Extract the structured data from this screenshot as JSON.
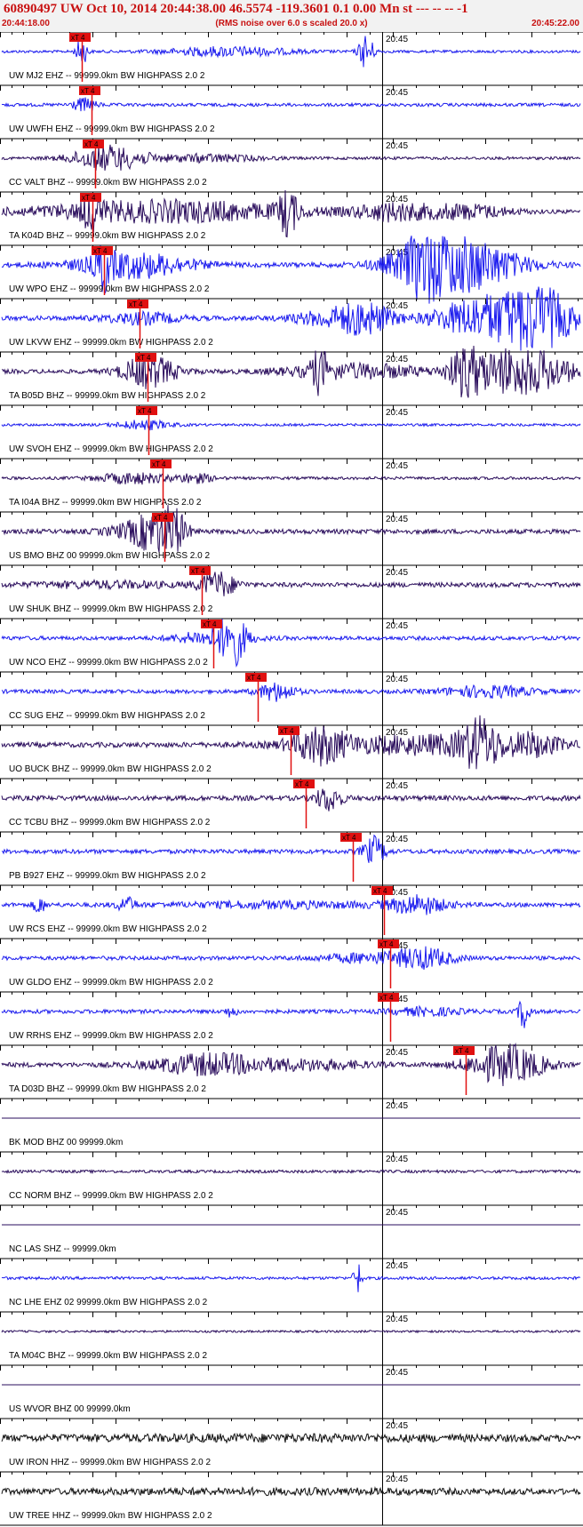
{
  "header": {
    "title": "60890497 UW Oct 10, 2014 20:44:38.00   46.5574 -119.3601  0.1 0.00 Mn st --- -- --  -1",
    "start_time": "20:44:18.00",
    "rms_note": "(RMS noise over 6.0 s scaled 20.0 x)",
    "end_time": "20:45:22.00"
  },
  "time_mark": "20:45",
  "pick_label": "xT 4",
  "colors": {
    "blue": "#1a1aee",
    "dark": "#2a0d5c",
    "black": "#111111",
    "red": "#e01010"
  },
  "traces": [
    {
      "label": "UW MJ2 EHZ -- 99999.0km BW  HIGHPASS  2.0  2",
      "color": "blue"
    },
    {
      "label": "UW UWFH EHZ -- 99999.0km BW  HIGHPASS  2.0  2",
      "color": "blue"
    },
    {
      "label": "CC VALT BHZ -- 99999.0km BW  HIGHPASS  2.0  2",
      "color": "dark"
    },
    {
      "label": "TA K04D BHZ -- 99999.0km BW  HIGHPASS  2.0  2",
      "color": "dark"
    },
    {
      "label": "UW WPO EHZ -- 99999.0km BW  HIGHPASS  2.0  2",
      "color": "blue"
    },
    {
      "label": "UW LKVW EHZ -- 99999.0km BW  HIGHPASS  2.0  2",
      "color": "blue"
    },
    {
      "label": "TA B05D BHZ -- 99999.0km BW  HIGHPASS  2.0  2",
      "color": "dark"
    },
    {
      "label": "UW SVOH EHZ -- 99999.0km BW  HIGHPASS  2.0  2",
      "color": "blue"
    },
    {
      "label": "TA I04A BHZ -- 99999.0km BW  HIGHPASS  2.0  2",
      "color": "dark"
    },
    {
      "label": "US BMO BHZ 00 99999.0km BW  HIGHPASS  2.0  2",
      "color": "dark"
    },
    {
      "label": "UW SHUK BHZ -- 99999.0km BW  HIGHPASS  2.0  2",
      "color": "dark"
    },
    {
      "label": "UW NCO EHZ -- 99999.0km BW  HIGHPASS  2.0  2",
      "color": "blue"
    },
    {
      "label": "CC SUG EHZ -- 99999.0km BW  HIGHPASS  2.0  2",
      "color": "blue"
    },
    {
      "label": "UO BUCK BHZ -- 99999.0km BW  HIGHPASS  2.0  2",
      "color": "dark"
    },
    {
      "label": "CC TCBU BHZ -- 99999.0km BW  HIGHPASS  2.0  2",
      "color": "dark"
    },
    {
      "label": "PB B927 EHZ -- 99999.0km BW  HIGHPASS  2.0  2",
      "color": "blue"
    },
    {
      "label": "UW RCS EHZ -- 99999.0km BW  HIGHPASS  2.0  2",
      "color": "blue"
    },
    {
      "label": "UW GLDO EHZ -- 99999.0km BW  HIGHPASS  2.0  2",
      "color": "blue"
    },
    {
      "label": "UW RRHS EHZ -- 99999.0km BW  HIGHPASS  2.0  2",
      "color": "blue"
    },
    {
      "label": "TA D03D BHZ -- 99999.0km BW  HIGHPASS  2.0  2",
      "color": "dark"
    },
    {
      "label": "BK MOD BHZ 00 99999.0km",
      "color": "dark"
    },
    {
      "label": "CC NORM BHZ -- 99999.0km BW  HIGHPASS  2.0  2",
      "color": "dark"
    },
    {
      "label": "NC LAS SHZ -- 99999.0km",
      "color": "dark"
    },
    {
      "label": "NC LHE EHZ 02 99999.0km BW  HIGHPASS  2.0  2",
      "color": "blue"
    },
    {
      "label": "TA M04C BHZ -- 99999.0km BW  HIGHPASS  2.0  2",
      "color": "dark"
    },
    {
      "label": "US WVOR BHZ 00 99999.0km",
      "color": "dark"
    },
    {
      "label": "UW IRON HHZ -- 99999.0km BW  HIGHPASS  2.0  2",
      "color": "black"
    },
    {
      "label": "UW TREE HHZ -- 99999.0km BW  HIGHPASS  2.0  2",
      "color": "black"
    }
  ]
}
